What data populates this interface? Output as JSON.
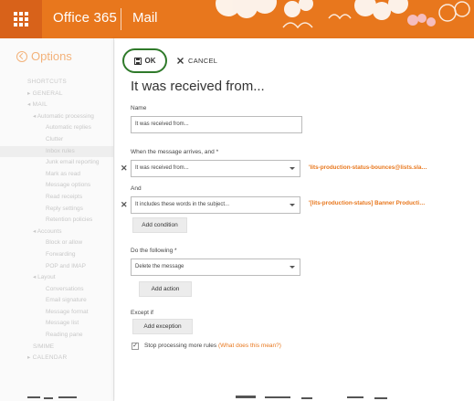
{
  "header": {
    "app_name": "Office 365",
    "module_name": "Mail"
  },
  "nav": {
    "back_label": "Options",
    "items": [
      {
        "label": "SHORTCUTS",
        "level": 0
      },
      {
        "label": "▸ GENERAL",
        "level": 0
      },
      {
        "label": "◂ MAIL",
        "level": 0
      },
      {
        "label": "◂ Automatic processing",
        "level": 1
      },
      {
        "label": "Automatic replies",
        "level": 2
      },
      {
        "label": "Clutter",
        "level": 2
      },
      {
        "label": "Inbox rules",
        "level": 2,
        "selected": true
      },
      {
        "label": "Junk email reporting",
        "level": 2
      },
      {
        "label": "Mark as read",
        "level": 2
      },
      {
        "label": "Message options",
        "level": 2
      },
      {
        "label": "Read receipts",
        "level": 2
      },
      {
        "label": "Reply settings",
        "level": 2
      },
      {
        "label": "Retention policies",
        "level": 2
      },
      {
        "label": "◂ Accounts",
        "level": 1
      },
      {
        "label": "Block or allow",
        "level": 2
      },
      {
        "label": "Forwarding",
        "level": 2
      },
      {
        "label": "POP and IMAP",
        "level": 2
      },
      {
        "label": "◂ Layout",
        "level": 1
      },
      {
        "label": "Conversations",
        "level": 2
      },
      {
        "label": "Email signature",
        "level": 2
      },
      {
        "label": "Message format",
        "level": 2
      },
      {
        "label": "Message list",
        "level": 2
      },
      {
        "label": "Reading pane",
        "level": 2
      },
      {
        "label": "S/MIME",
        "level": 1
      },
      {
        "label": "▸ CALENDAR",
        "level": 0
      }
    ]
  },
  "toolbar": {
    "ok_label": "OK",
    "cancel_label": "CANCEL"
  },
  "form": {
    "title": "It was received from...",
    "name_label": "Name",
    "name_value": "It was received from...",
    "when_label": "When the message arrives, and *",
    "condition1_value": "It was received from...",
    "condition1_detail": "'lits-production-status-bounces@lists.sla…",
    "and_label": "And",
    "condition2_value": "It includes these words in the subject...",
    "condition2_detail": "'[lits-production-status] Banner Producti…",
    "add_condition_label": "Add condition",
    "do_following_label": "Do the following *",
    "action_value": "Delete the message",
    "add_action_label": "Add action",
    "except_label": "Except if",
    "add_exception_label": "Add exception",
    "stop_checked": true,
    "stop_label": "Stop processing more rules",
    "stop_help_link": "(What does this mean?)"
  },
  "colors": {
    "brand_orange": "#e8771d",
    "ok_ring_green": "#2f7a2a"
  }
}
